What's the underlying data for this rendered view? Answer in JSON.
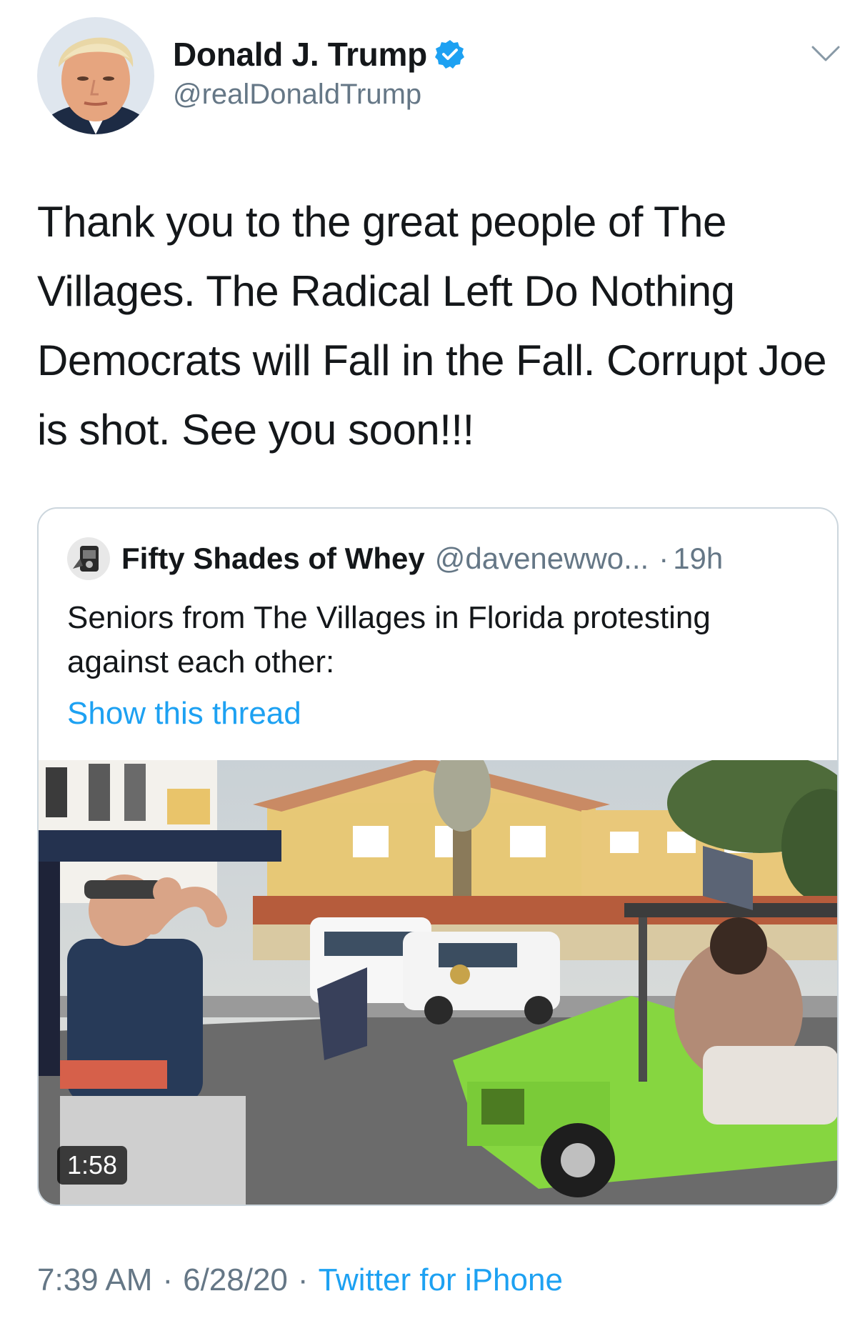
{
  "tweet": {
    "display_name": "Donald J. Trump",
    "handle": "@realDonaldTrump",
    "verified": true,
    "text": "Thank you to the great people of The Villages. The Radical Left Do Nothing Democrats will Fall in the Fall. Corrupt Joe is shot. See you soon!!!"
  },
  "quoted_tweet": {
    "display_name": "Fifty Shades of Whey",
    "handle": "@davenewwo...",
    "separator": "·",
    "time": "19h",
    "text": "Seniors from The Villages in Florida protesting against each other:",
    "show_thread": "Show this thread",
    "video_duration": "1:58"
  },
  "footer": {
    "time": "7:39 AM",
    "date": "6/28/20",
    "separator": "·",
    "source": "Twitter for iPhone"
  },
  "colors": {
    "link_blue": "#1da1f2",
    "secondary_text": "#657786",
    "primary_text": "#14171a",
    "card_border": "#ccd6dd",
    "cart_green": "#86d640"
  },
  "icons": {
    "verified": "verified-badge-icon",
    "menu": "chevron-down-icon"
  }
}
